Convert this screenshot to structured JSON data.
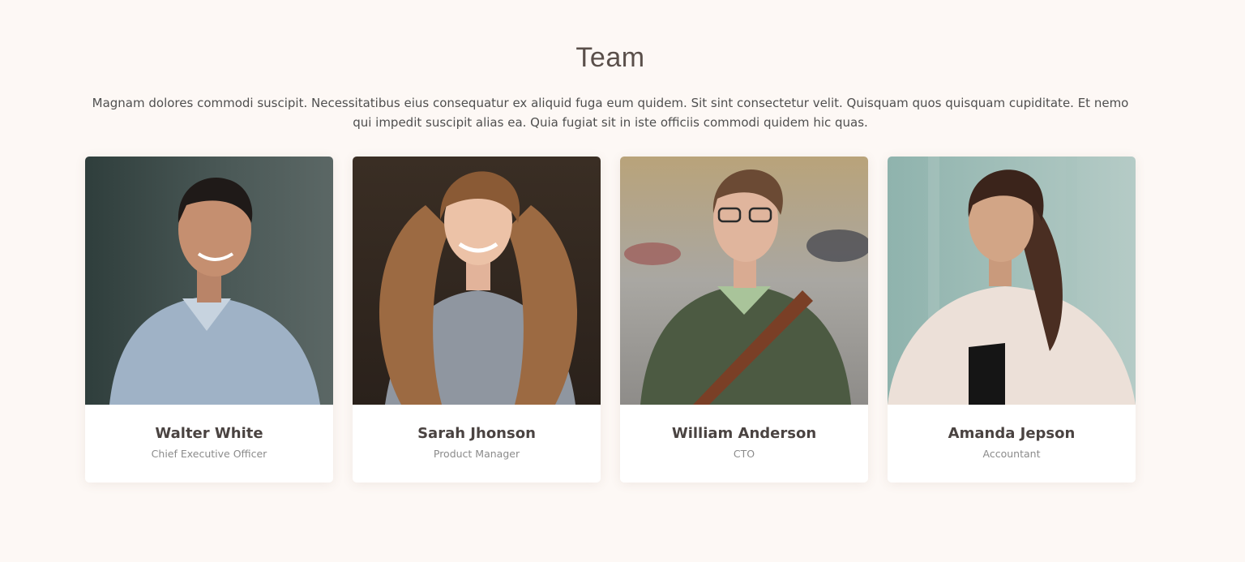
{
  "section": {
    "title": "Team",
    "description": "Magnam dolores commodi suscipit. Necessitatibus eius consequatur ex aliquid fuga eum quidem. Sit sint consectetur velit. Quisquam quos quisquam cupiditate. Et nemo qui impedit suscipit alias ea. Quia fugiat sit in iste officiis commodi quidem hic quas."
  },
  "team": [
    {
      "name": "Walter White",
      "role": "Chief Executive Officer"
    },
    {
      "name": "Sarah Jhonson",
      "role": "Product Manager"
    },
    {
      "name": "William Anderson",
      "role": "CTO"
    },
    {
      "name": "Amanda Jepson",
      "role": "Accountant"
    }
  ],
  "colors": {
    "background": "#fdf8f5",
    "card": "#ffffff",
    "title": "#5a4f4a",
    "name": "#4a4341",
    "role": "#8b8b8b"
  }
}
